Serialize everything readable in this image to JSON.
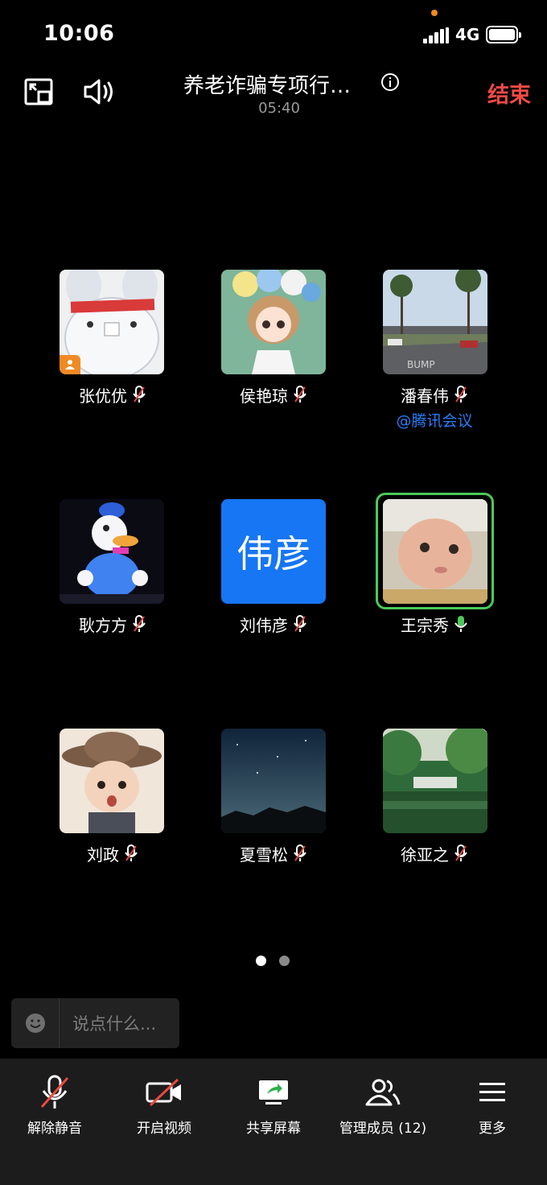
{
  "status_bar": {
    "time": "10:06",
    "network": "4G"
  },
  "header": {
    "title": "养老诈骗专项行…",
    "timer": "05:40",
    "end_label": "结束"
  },
  "participants": [
    {
      "name": "张优优",
      "mic": "muted",
      "avatar": "cartoon-rabbit-photo",
      "host": true
    },
    {
      "name": "侯艳琼",
      "mic": "muted",
      "avatar": "anime-girl-photo"
    },
    {
      "name": "潘春伟",
      "mic": "muted",
      "avatar": "palm-street-photo",
      "tag": "@腾讯会议"
    },
    {
      "name": "耿方方",
      "mic": "muted",
      "avatar": "donald-duck-photo"
    },
    {
      "name": "刘伟彦",
      "mic": "muted",
      "avatar_text": "伟彦"
    },
    {
      "name": "王宗秀",
      "mic": "speaking",
      "avatar": "baby-photo"
    },
    {
      "name": "刘政",
      "mic": "muted",
      "avatar": "child-hat-photo"
    },
    {
      "name": "夏雪松",
      "mic": "muted",
      "avatar": "night-sky-photo"
    },
    {
      "name": "徐亚之",
      "mic": "muted",
      "avatar": "green-park-photo"
    }
  ],
  "pager": {
    "current": 1,
    "total": 2
  },
  "chat": {
    "placeholder": "说点什么..."
  },
  "toolbar": [
    {
      "label": "解除静音",
      "icon": "mic-muted-icon"
    },
    {
      "label": "开启视频",
      "icon": "video-off-icon"
    },
    {
      "label": "共享屏幕",
      "icon": "share-screen-icon"
    },
    {
      "label": "管理成员 (12)",
      "icon": "members-icon"
    },
    {
      "label": "更多",
      "icon": "menu-icon"
    }
  ],
  "colors": {
    "end": "#f04a46",
    "accent_blue": "#1676f3",
    "speaking": "#4cc95a",
    "host_badge": "#f08a24"
  }
}
